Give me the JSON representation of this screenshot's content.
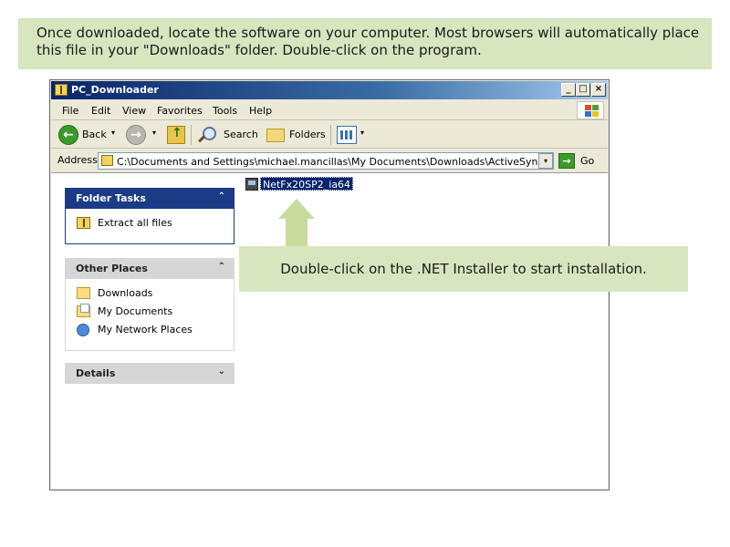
{
  "instructions": {
    "top": "Once downloaded, locate the software on your computer. Most browsers will automatically place this file in your \"Downloads\" folder. Double-click on the program.",
    "middle": "Double-click on the .NET Installer to start installation."
  },
  "window": {
    "title": "PC_Downloader",
    "controls": {
      "minimize": "_",
      "maximize": "□",
      "close": "×"
    }
  },
  "menu": [
    "File",
    "Edit",
    "View",
    "Favorites",
    "Tools",
    "Help"
  ],
  "toolbar": {
    "back": "Back",
    "search": "Search",
    "folders": "Folders",
    "caret": "▾"
  },
  "address": {
    "label": "Address",
    "path": "C:\\Documents and Settings\\michael.mancillas\\My Documents\\Downloads\\ActiveSync",
    "go": "Go",
    "dropdown": "▾"
  },
  "folder_tasks": {
    "title": "Folder Tasks",
    "collapse": "⌃",
    "items": [
      "Extract all files"
    ]
  },
  "other_places": {
    "title": "Other Places",
    "collapse": "⌃",
    "items": [
      "Downloads",
      "My Documents",
      "My Network Places"
    ]
  },
  "details": {
    "title": "Details",
    "expand": "⌄"
  },
  "files": [
    {
      "name": "NetFx20SP2_ia64",
      "selected": true
    }
  ],
  "colors": {
    "callout_bg": "#d8e6c0",
    "task_header": "#1b3b86",
    "selection": "#0a246a"
  }
}
